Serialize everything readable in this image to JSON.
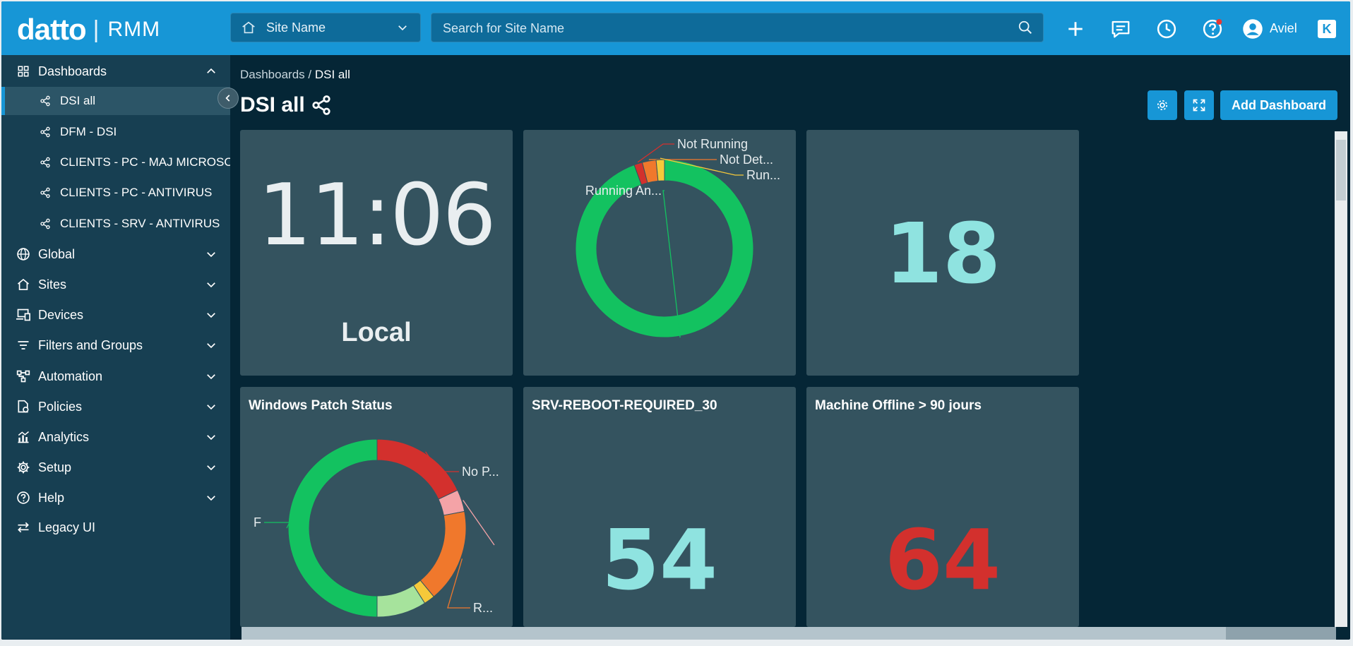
{
  "header": {
    "brand": "datto",
    "product": "RMM",
    "site_select": "Site Name",
    "search_placeholder": "Search for Site Name",
    "user": "Aviel"
  },
  "sidebar": {
    "dashboards": "Dashboards",
    "dashboard_items": [
      "DSI all",
      "DFM - DSI",
      "CLIENTS - PC - MAJ MICROSOFT",
      "CLIENTS - PC - ANTIVIRUS",
      "CLIENTS - SRV - ANTIVIRUS"
    ],
    "sections": [
      "Global",
      "Sites",
      "Devices",
      "Filters and Groups",
      "Automation",
      "Policies",
      "Analytics",
      "Setup",
      "Help",
      "Legacy UI"
    ]
  },
  "breadcrumb": {
    "root": "Dashboards",
    "separator": " / ",
    "current": "DSI all"
  },
  "page": {
    "title": "DSI all",
    "add_dashboard": "Add Dashboard"
  },
  "tiles": {
    "clock": {
      "time": "11:06",
      "zone": "Local"
    },
    "antivirus": {
      "labels": [
        "Not Running",
        "Not Det...",
        "Run...",
        "Running An..."
      ]
    },
    "count1": {
      "value": "18"
    },
    "patch": {
      "title": "Windows Patch Status",
      "labels": [
        "No P...",
        "F",
        "R..."
      ]
    },
    "reboot": {
      "title": "SRV-REBOOT-REQUIRED_30",
      "value": "54"
    },
    "offline": {
      "title": "Machine Offline > 90 jours",
      "value": "64"
    }
  },
  "chart_data": [
    {
      "type": "pie",
      "title": "",
      "slices": [
        {
          "label": "Running An...",
          "value": 94,
          "color": "#13c260"
        },
        {
          "label": "Not Running",
          "value": 1.5,
          "color": "#d3302d"
        },
        {
          "label": "Not Det...",
          "value": 2.5,
          "color": "#f0782c"
        },
        {
          "label": "Run...",
          "value": 1.5,
          "color": "#f6c93a"
        }
      ]
    },
    {
      "type": "pie",
      "title": "Windows Patch Status",
      "slices": [
        {
          "label": "No P...",
          "value": 18,
          "color": "#d3302d"
        },
        {
          "label": "",
          "value": 4,
          "color": "#f4a3a7"
        },
        {
          "label": "R...",
          "value": 17,
          "color": "#f0782c"
        },
        {
          "label": "",
          "value": 2,
          "color": "#f6c93a"
        },
        {
          "label": "",
          "value": 9,
          "color": "#a6e39c"
        },
        {
          "label": "F",
          "value": 50,
          "color": "#13c260"
        }
      ]
    }
  ],
  "colors": {
    "accent": "#1796d6",
    "tile": "#34535f",
    "cyan_value": "#8fe3e0",
    "red_value": "#d3302d"
  }
}
